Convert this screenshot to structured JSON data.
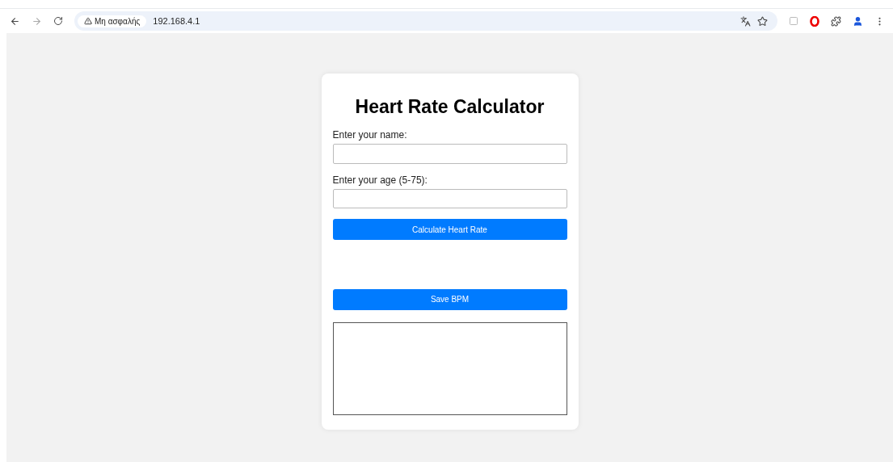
{
  "browser": {
    "security_label": "Μη ασφαλής",
    "address": "192.168.4.1"
  },
  "card": {
    "title": "Heart Rate Calculator",
    "fields": [
      {
        "label": "Enter your name:"
      },
      {
        "label": "Enter your age (5-75):"
      }
    ],
    "calculate_button": "Calculate Heart Rate",
    "save_button": "Save BPM"
  }
}
